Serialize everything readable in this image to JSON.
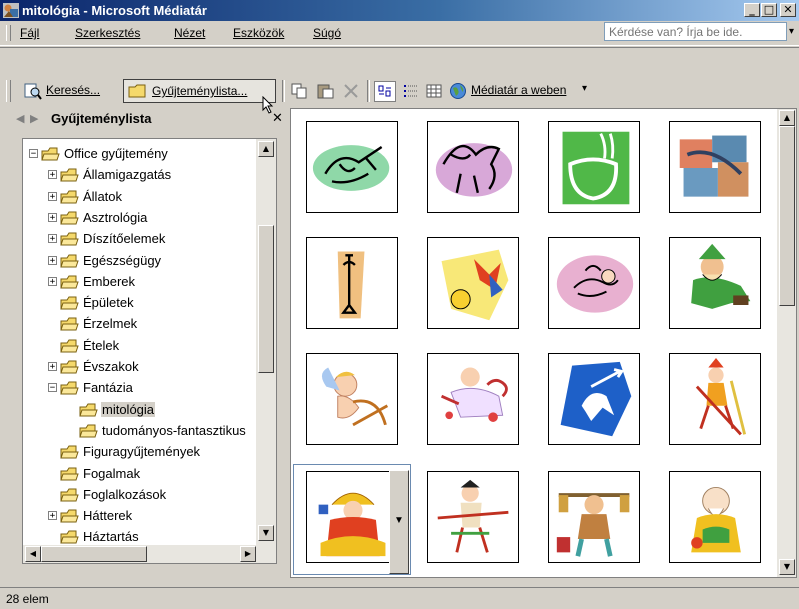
{
  "window": {
    "title": "mitológia - Microsoft Médiatár",
    "buttons": [
      "_",
      "□",
      "✕"
    ]
  },
  "menu": {
    "items": [
      "Fájl",
      "Szerkesztés",
      "Nézet",
      "Eszközök",
      "Súgó"
    ],
    "ask_placeholder": "Kérdése van? Írja be ide."
  },
  "toolbar": {
    "search_label": "Keresés...",
    "collections_label": "Gyűjteménylista...",
    "web_label": "Médiatár a weben"
  },
  "nav": {
    "title": "Gyűjteménylista"
  },
  "tree": {
    "items": [
      {
        "label": "Office gyűjtemény",
        "expander": "−"
      },
      {
        "label": "Államigazgatás",
        "expander": "+"
      },
      {
        "label": "Állatok",
        "expander": "+"
      },
      {
        "label": "Asztrológia",
        "expander": "+"
      },
      {
        "label": "Díszítőelemek",
        "expander": "+"
      },
      {
        "label": "Egészségügy",
        "expander": "+"
      },
      {
        "label": "Emberek",
        "expander": "+"
      },
      {
        "label": "Épületek",
        "expander": ""
      },
      {
        "label": "Érzelmek",
        "expander": ""
      },
      {
        "label": "Ételek",
        "expander": ""
      },
      {
        "label": "Évszakok",
        "expander": "+"
      },
      {
        "label": "Fantázia",
        "expander": "−"
      },
      {
        "label": "mitológia",
        "expander": ""
      },
      {
        "label": "tudományos-fantasztikus",
        "expander": ""
      },
      {
        "label": "Figuragyűjtemények",
        "expander": ""
      },
      {
        "label": "Fogalmak",
        "expander": ""
      },
      {
        "label": "Foglalkozások",
        "expander": ""
      },
      {
        "label": "Hátterek",
        "expander": "+"
      },
      {
        "label": "Háztartás",
        "expander": ""
      }
    ]
  },
  "gallery": {
    "clips": [
      "bull-clip",
      "pegasus-clip",
      "cauldron-clip",
      "mosaic-clip",
      "trident-key-clip",
      "sun-star-clip",
      "cherub-pink-clip",
      "leprechaun-clip",
      "cupid-clip",
      "cupid-heart-clip",
      "centaur-clip",
      "jester-clip",
      "emperor-clip",
      "warrior-clip",
      "porter-clip",
      "sage-clip"
    ]
  },
  "status": {
    "text": "28 elem"
  },
  "colors": {
    "title_start": "#0a246a",
    "title_end": "#a6caf0",
    "face": "#d4d0c8",
    "folder": "#f5d96b"
  }
}
